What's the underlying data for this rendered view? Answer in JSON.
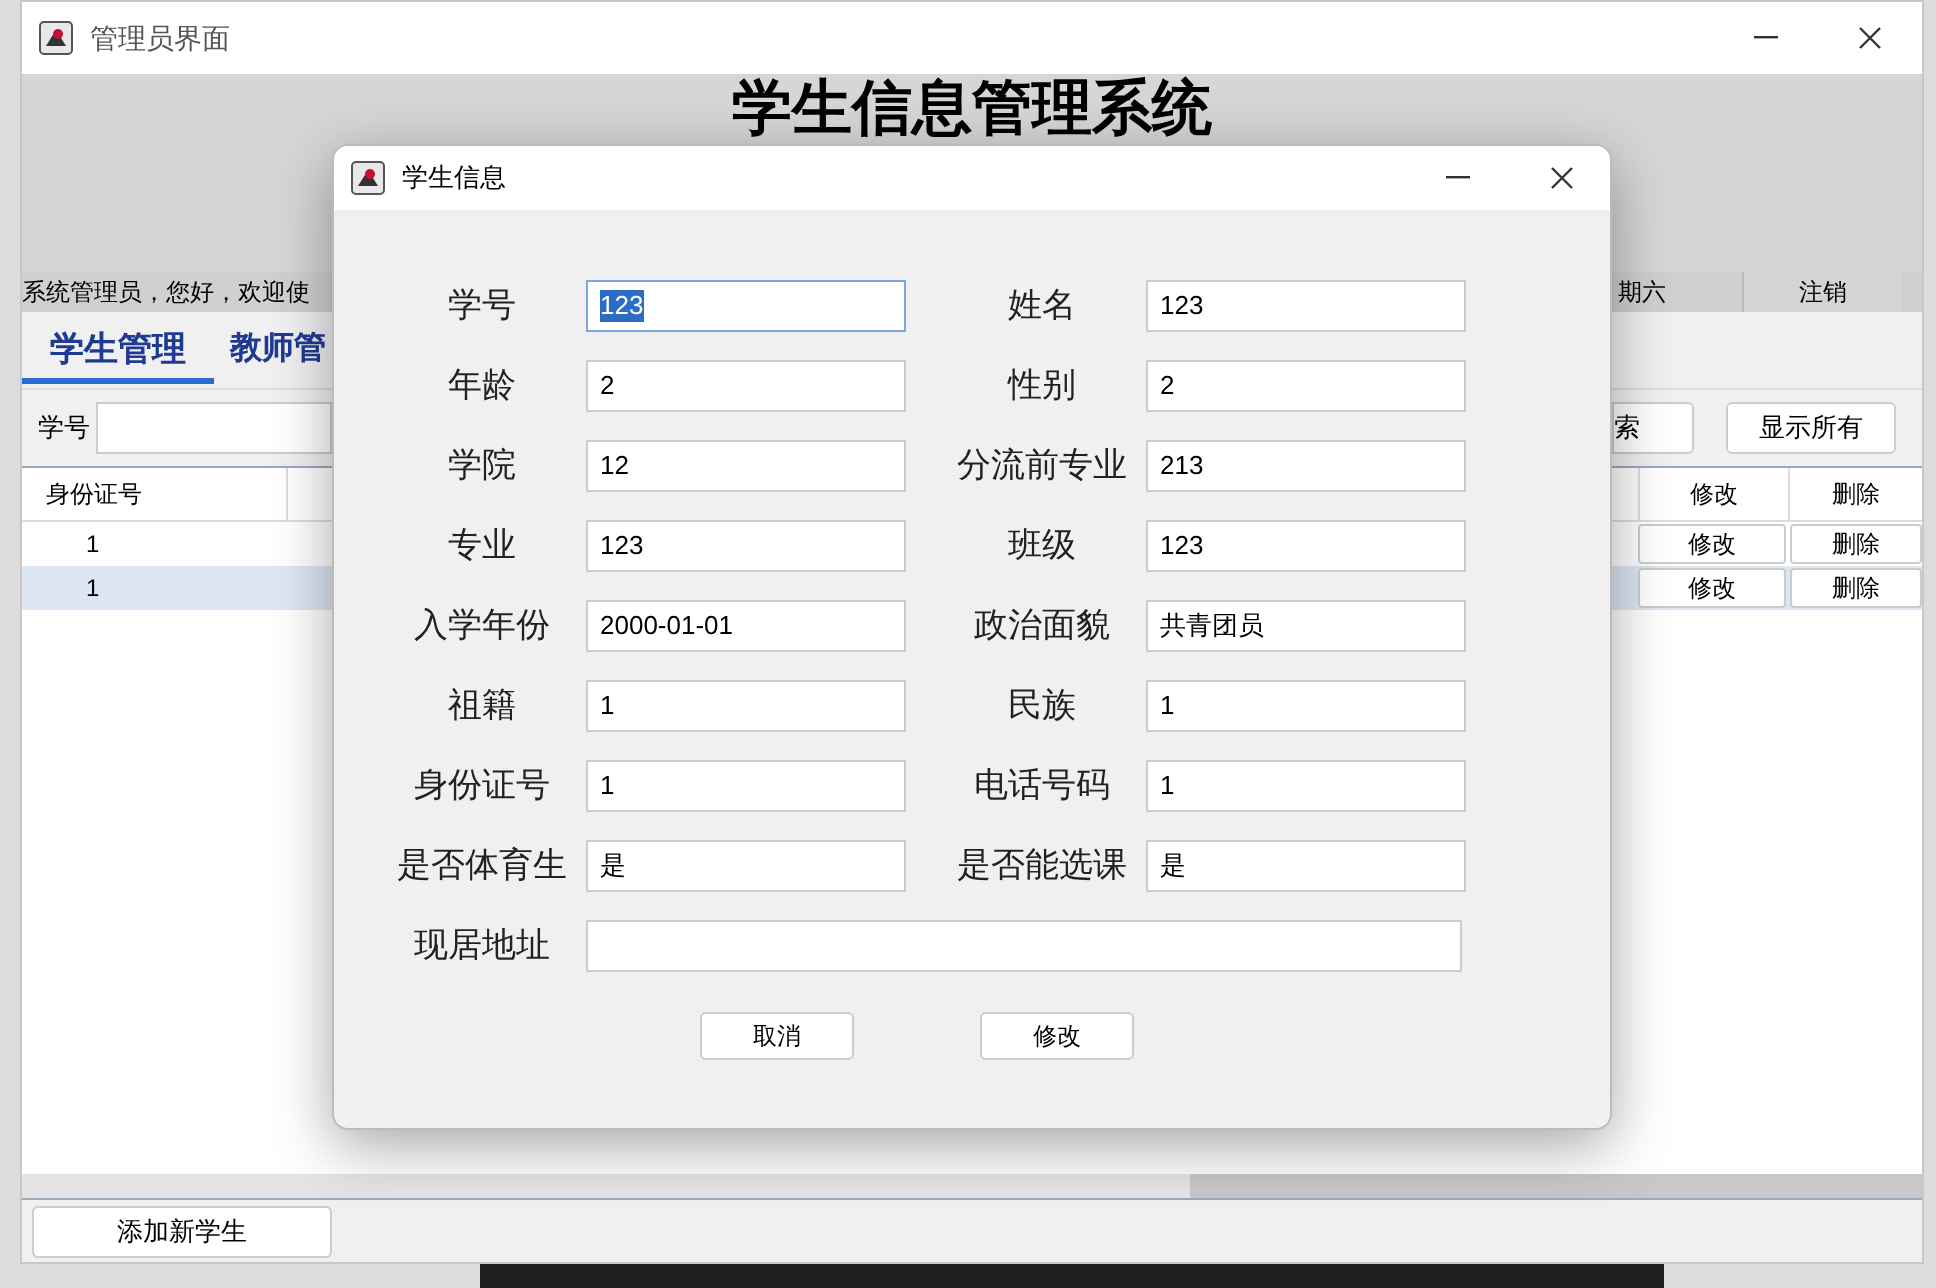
{
  "window": {
    "title": "管理员界面"
  },
  "header": {
    "title": "学生信息管理系统"
  },
  "info_bar": {
    "greeting": "系统管理员，您好，欢迎使",
    "date": "期六",
    "logout": "注销"
  },
  "tabs": [
    {
      "label": "学生管理",
      "selected": true
    },
    {
      "label": "教师管",
      "selected": false
    }
  ],
  "search": {
    "label": "学号",
    "buttons": [
      "索",
      "显示所有"
    ]
  },
  "table": {
    "columns": [
      "身份证号",
      "修改",
      "删除"
    ],
    "rows": [
      {
        "cells": [
          "1"
        ],
        "actions": [
          "修改",
          "删除"
        ],
        "selected": false
      },
      {
        "cells": [
          "1"
        ],
        "actions": [
          "修改",
          "删除"
        ],
        "selected": true
      }
    ]
  },
  "add_button": "添加新学生",
  "dialog": {
    "title": "学生信息",
    "fields": [
      {
        "label": "学号",
        "value": "123",
        "focused": true
      },
      {
        "label": "姓名",
        "value": "123",
        "focused": false
      },
      {
        "label": "年龄",
        "value": "2",
        "focused": false
      },
      {
        "label": "性别",
        "value": "2",
        "focused": false
      },
      {
        "label": "学院",
        "value": "12",
        "focused": false
      },
      {
        "label": "分流前专业",
        "value": "213",
        "focused": false
      },
      {
        "label": "专业",
        "value": "123",
        "focused": false
      },
      {
        "label": "班级",
        "value": "123",
        "focused": false
      },
      {
        "label": "入学年份",
        "value": "2000-01-01",
        "focused": false
      },
      {
        "label": "政治面貌",
        "value": "共青团员",
        "focused": false
      },
      {
        "label": "祖籍",
        "value": "1",
        "focused": false
      },
      {
        "label": "民族",
        "value": "1",
        "focused": false
      },
      {
        "label": "身份证号",
        "value": "1",
        "focused": false
      },
      {
        "label": "电话号码",
        "value": "1",
        "focused": false
      },
      {
        "label": "是否体育生",
        "value": "是",
        "focused": false
      },
      {
        "label": "是否能选课",
        "value": "是",
        "focused": false
      }
    ],
    "address": {
      "label": "现居地址"
    },
    "buttons": [
      "取消",
      "修改"
    ]
  }
}
